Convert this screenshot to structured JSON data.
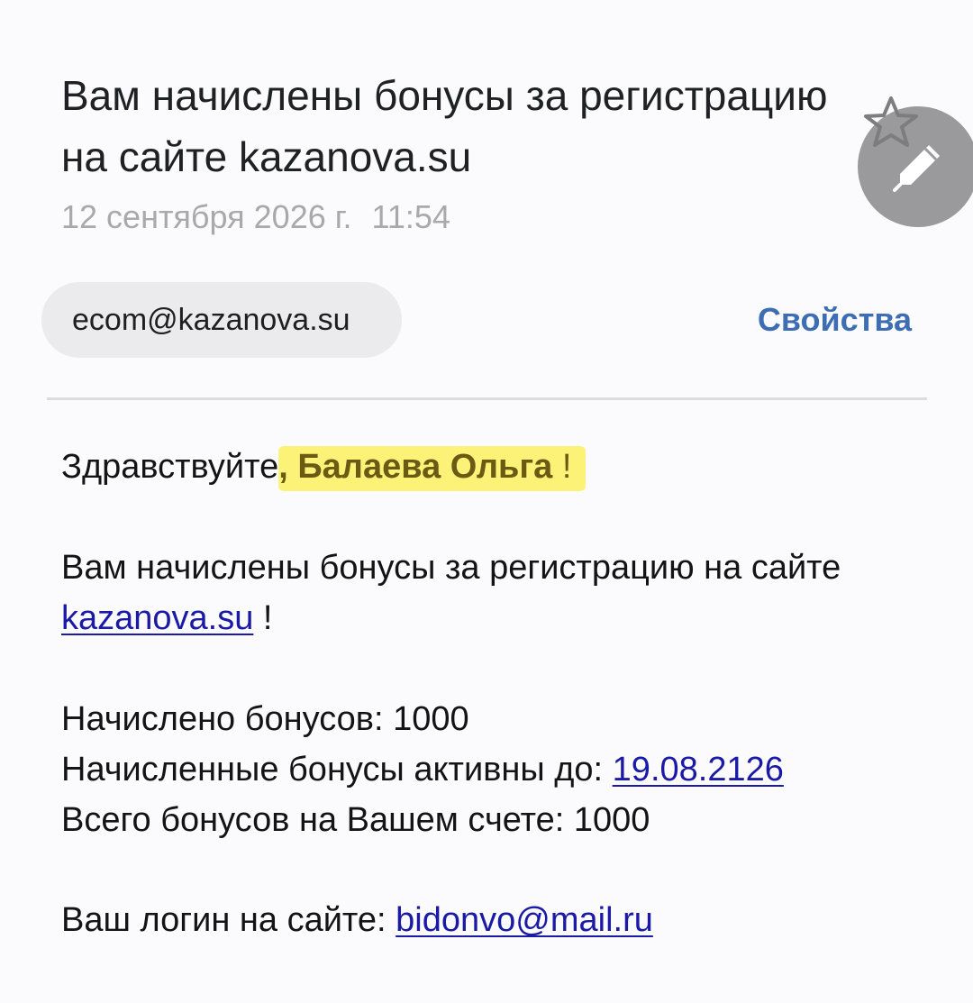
{
  "email": {
    "subject": "Вам начислены бонусы за регистрацию на сайте kazanova.su",
    "date": "12 сентября 2026 г.",
    "time": "11:54",
    "sender": "ecom@kazanova.su",
    "properties_label": "Свойства"
  },
  "icons": {
    "star": "star-outline-icon",
    "compose": "pencil-icon"
  },
  "body": {
    "greeting_prefix": "Здравствуйте",
    "greeting_name": ", Балаева Ольга",
    "greeting_suffix": " !",
    "message_text": "Вам начислены бонусы за регистрацию на сайте",
    "message_link": "kazanova.su",
    "message_suffix": " !",
    "accrued_label": "Начислено бонусов:",
    "accrued_value": "1000",
    "active_until_label": "Начисленные бонусы активны до:",
    "active_until_value": "19.08.2126",
    "total_label": "Всего бонусов на Вашем счете:",
    "total_value": "1000",
    "login_label": "Ваш логин на сайте:",
    "login_value": "bidonvo@mail.ru"
  },
  "colors": {
    "highlight": "#fbf277",
    "link": "#1a1aa6",
    "accent": "#3d6eb3",
    "fab": "#9a9a9c"
  }
}
